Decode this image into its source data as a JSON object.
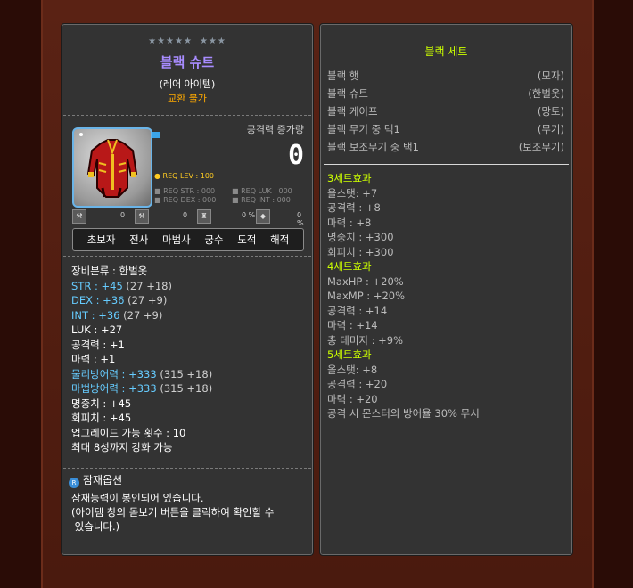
{
  "item": {
    "stars_group1": "★★★★★",
    "stars_group2": "★★★",
    "name": "블랙 슈트",
    "rarity": "(레어 아이템)",
    "trade": "교환 불가",
    "attack_label": "공격력 증가량",
    "attack_value": "0",
    "req_lev": "● REQ LEV : 100",
    "req_str": "■ REQ STR : 000",
    "req_luk": "■ REQ LUK : 000",
    "req_dex": "■ REQ DEX : 000",
    "req_int": "■ REQ INT : 000",
    "stat_values": [
      "0",
      "0",
      "0 %",
      "0 %"
    ],
    "jobs": [
      "초보자",
      "전사",
      "마법사",
      "궁수",
      "도적",
      "해적"
    ],
    "category": "장비분류 : 한벌옷",
    "str_label": "STR : +45",
    "str_detail": " (27 +18)",
    "dex_label": "DEX : +36",
    "dex_detail": " (27 +9)",
    "int_label": "INT : +36",
    "int_detail": " (27 +9)",
    "luk": "LUK : +27",
    "attack": "공격력 : +1",
    "magic": "마력 : +1",
    "pdef_label": "물리방어력 : +333",
    "pdef_detail": " (315 +18)",
    "mdef_label": "마법방어력 : +333",
    "mdef_detail": " (315 +18)",
    "accuracy": "명중치 : +45",
    "avoid": "회피치 : +45",
    "upgrades": "업그레이드 가능 횟수 : 10",
    "starforce": "최대 8성까지 강화 가능",
    "potential_icon": "R",
    "potential_title": "잠재옵션",
    "potential_desc1": "잠재능력이 봉인되어 있습니다.",
    "potential_desc2": "(아이템 창의 돋보기 버튼을 클릭하여 확인할 수",
    "potential_desc3": " 있습니다.)"
  },
  "set": {
    "title": "블랙 세트",
    "items": [
      {
        "name": "블랙 햇",
        "slot": "(모자)"
      },
      {
        "name": "블랙 슈트",
        "slot": "(한벌옷)"
      },
      {
        "name": "블랙 케이프",
        "slot": "(망토)"
      },
      {
        "name": "블랙 무기 중 택1",
        "slot": "(무기)"
      },
      {
        "name": "블랙 보조무기 중 택1",
        "slot": "(보조무기)"
      }
    ],
    "effects": {
      "h3": "3세트효과",
      "e3": [
        "올스탯: +7",
        "공격력 : +8",
        "마력 : +8",
        "명중치 : +300",
        "회피치 : +300"
      ],
      "h4": "4세트효과",
      "e4": [
        "MaxHP : +20%",
        "MaxMP : +20%",
        "공격력 : +14",
        "마력 : +14",
        "총 데미지 : +9%"
      ],
      "h5": "5세트효과",
      "e5": [
        "올스탯: +8",
        "공격력 : +20",
        "마력 : +20",
        "공격 시 몬스터의 방어율 30% 무시"
      ]
    }
  },
  "colors": {
    "name": "#a88cff",
    "trade": "#ffaa00",
    "set_highlight": "#ccff00",
    "stat_bonus": "#66ccff"
  }
}
